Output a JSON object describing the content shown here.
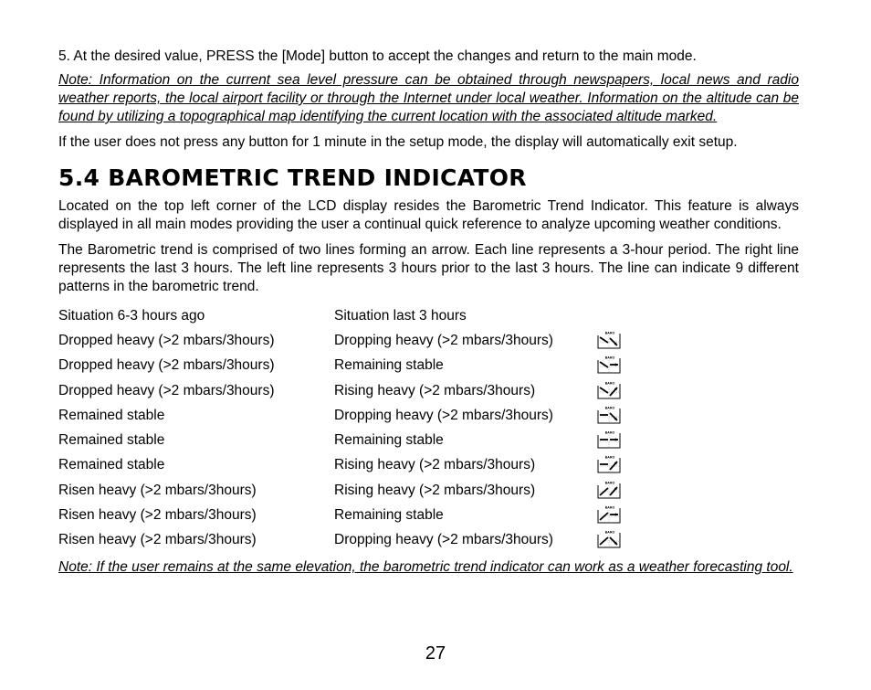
{
  "intro": {
    "step5": "5. At the desired value, PRESS the [Mode] button to accept  the changes and return to the main mode.",
    "note1": "Note: Information on the current sea level pressure can be obtained through newspapers, local news and radio weather reports, the local airport facility or through the Internet under local weather. Information on the altitude can be found by utilizing a topographical map identifying the current location with the associated altitude marked.",
    "timeout": "If the user does not press any button for 1 minute in the setup mode, the display will automatically exit setup."
  },
  "section": {
    "heading": "5.4 BAROMETRIC TREND INDICATOR",
    "para1": "Located on the top left corner of the LCD display resides the Barometric Trend Indicator. This feature is always displayed in all main modes providing the user a continual quick reference to analyze upcoming weather conditions.",
    "para2": "The Barometric trend is comprised of two lines forming an arrow. Each line represents a 3-hour period. The right line represents the last 3 hours. The left line represents 3 hours prior to the last 3 hours. The line can indicate 9 different patterns in the barometric trend."
  },
  "table": {
    "headers": [
      "Situation 6-3 hours ago",
      "Situation last 3 hours"
    ],
    "icon_label": "BARO",
    "rows": [
      {
        "prev": "Dropped heavy (>2 mbars/3hours)",
        "last": "Dropping heavy (>2 mbars/3hours)",
        "icon": "down-down"
      },
      {
        "prev": "Dropped heavy (>2 mbars/3hours)",
        "last": "Remaining stable",
        "icon": "down-flat"
      },
      {
        "prev": "Dropped heavy (>2 mbars/3hours)",
        "last": "Rising heavy (>2 mbars/3hours)",
        "icon": "down-up"
      },
      {
        "prev": "Remained stable",
        "last": "Dropping heavy (>2 mbars/3hours)",
        "icon": "flat-down"
      },
      {
        "prev": "Remained stable",
        "last": "Remaining stable",
        "icon": "flat-flat"
      },
      {
        "prev": "Remained stable",
        "last": "Rising heavy (>2 mbars/3hours)",
        "icon": "flat-up"
      },
      {
        "prev": "Risen heavy (>2 mbars/3hours)",
        "last": "Rising heavy (>2 mbars/3hours)",
        "icon": "up-up"
      },
      {
        "prev": "Risen heavy (>2 mbars/3hours)",
        "last": "Remaining stable",
        "icon": "up-flat"
      },
      {
        "prev": "Risen heavy (>2 mbars/3hours)",
        "last": "Dropping heavy (>2 mbars/3hours)",
        "icon": "up-down"
      }
    ]
  },
  "note2": "Note: If the user remains at the same elevation, the barometric trend indicator can work as a weather forecasting tool.",
  "page_number": "27"
}
